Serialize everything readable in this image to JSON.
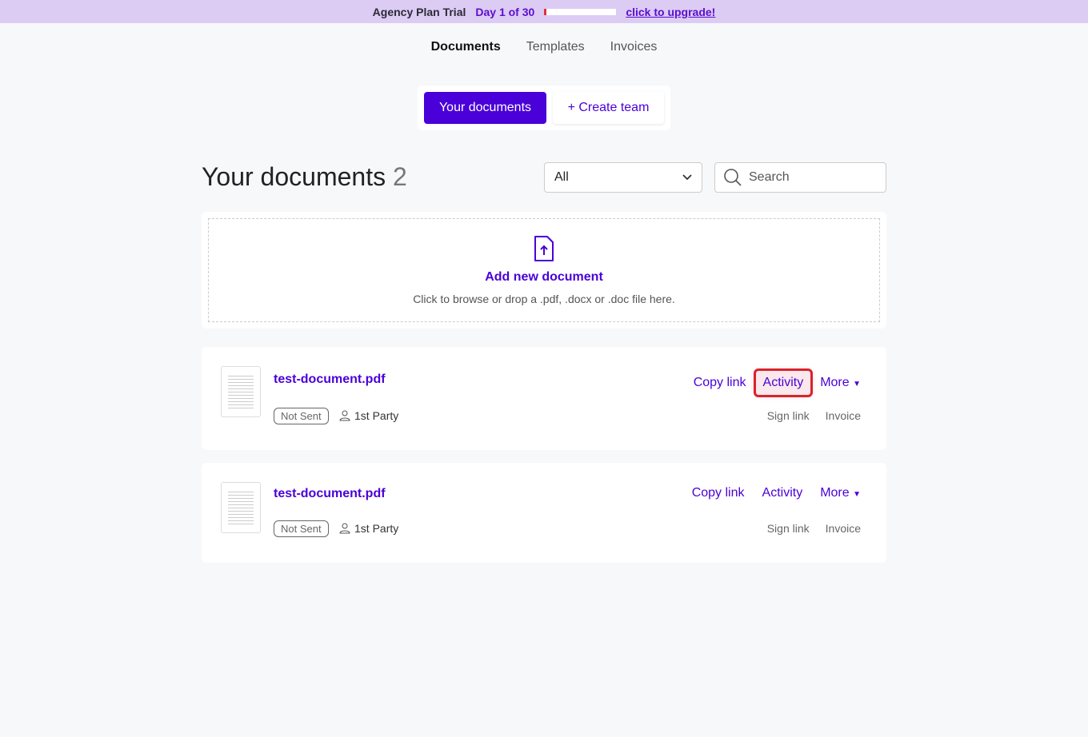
{
  "banner": {
    "plan": "Agency Plan Trial",
    "day": "Day 1 of 30",
    "progress": 0.033,
    "upgrade": "click to upgrade!"
  },
  "nav": [
    "Documents",
    "Templates",
    "Invoices"
  ],
  "segment": {
    "yours": "Your documents",
    "create": "+ Create team"
  },
  "heading": {
    "title": "Your documents",
    "count": "2"
  },
  "filter": {
    "value": "All"
  },
  "search": {
    "placeholder": "Search"
  },
  "upload": {
    "title": "Add new document",
    "subtitle": "Click to browse or drop a .pdf, .docx or .doc file here."
  },
  "documents": [
    {
      "name": "test-document.pdf",
      "status": "Not Sent",
      "party": "1st Party",
      "copy": "Copy link",
      "activity": "Activity",
      "more": "More",
      "sign": "Sign link",
      "invoice": "Invoice"
    },
    {
      "name": "test-document.pdf",
      "status": "Not Sent",
      "party": "1st Party",
      "copy": "Copy link",
      "activity": "Activity",
      "more": "More",
      "sign": "Sign link",
      "invoice": "Invoice"
    }
  ]
}
